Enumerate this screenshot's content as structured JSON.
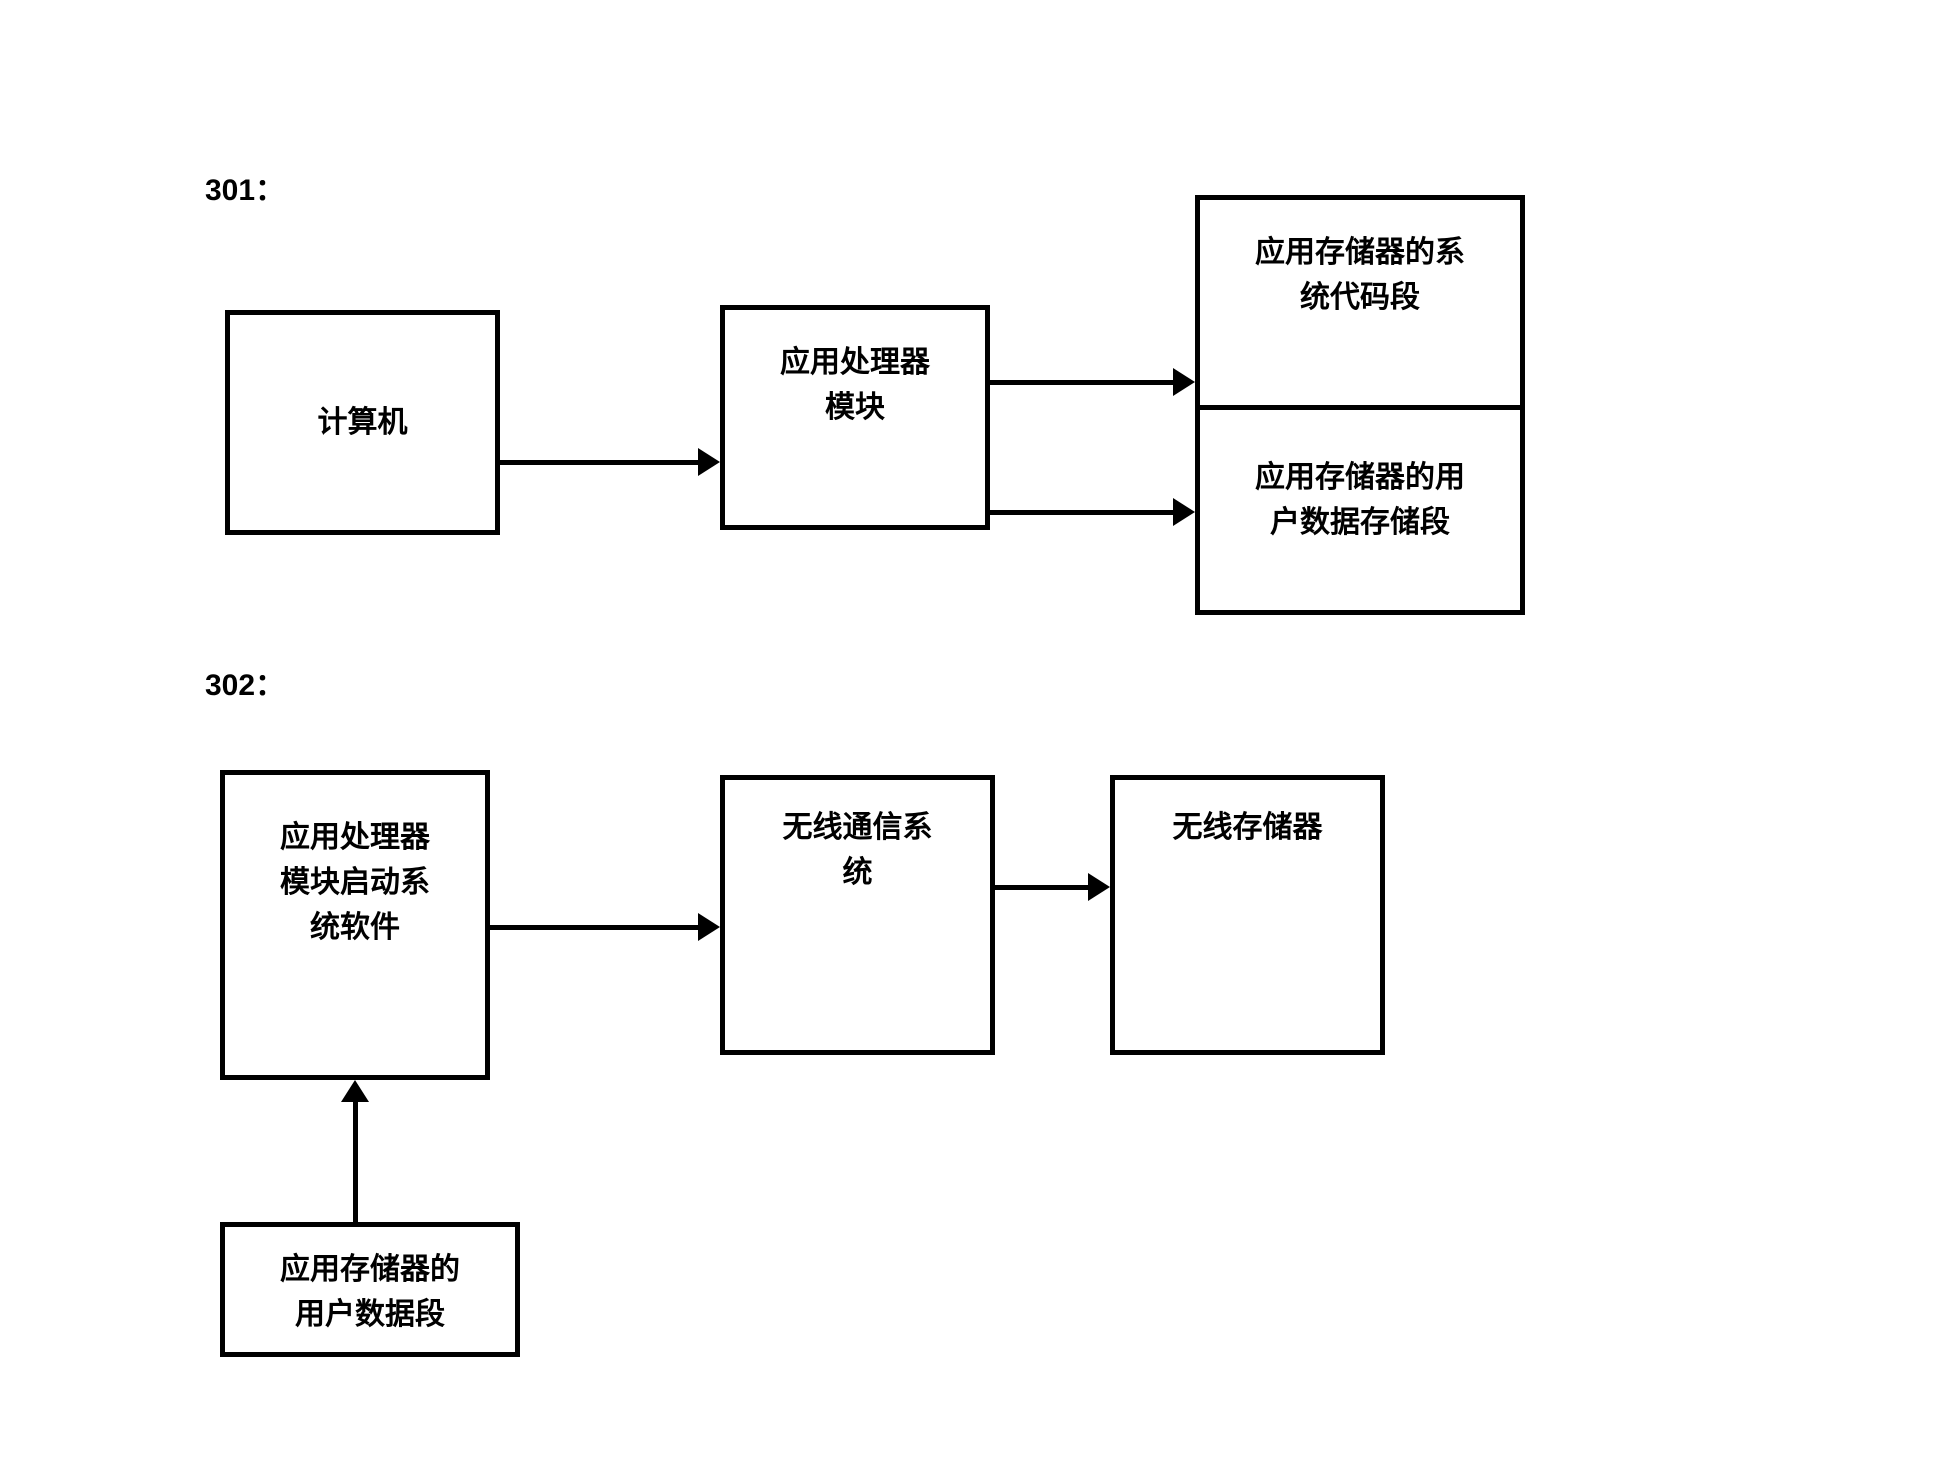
{
  "labels": {
    "step1": "301：",
    "step2": "302："
  },
  "boxes": {
    "computer": "计算机",
    "appProcessorModule": "应用处理器\n模块",
    "appMemSysCode": "应用存储器的系\n统代码段",
    "appMemUserData": "应用存储器的用\n户数据存储段",
    "appProcessorBoot": "应用处理器\n模块启动系\n统软件",
    "wirelessComm": "无线通信系\n统",
    "wirelessStorage": "无线存储器",
    "appMemUserSeg": "应用存储器的\n用户数据段"
  }
}
